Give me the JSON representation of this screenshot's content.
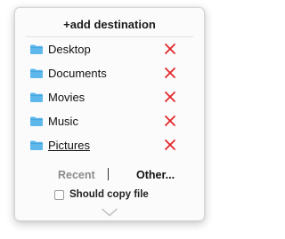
{
  "header": {
    "add_label": "+add destination"
  },
  "destinations": [
    {
      "label": "Desktop",
      "underlined": false
    },
    {
      "label": "Documents",
      "underlined": false
    },
    {
      "label": "Movies",
      "underlined": false
    },
    {
      "label": "Music",
      "underlined": false
    },
    {
      "label": "Pictures",
      "underlined": true
    }
  ],
  "icons": {
    "folder": "folder-icon",
    "remove": "remove-x-icon",
    "expand": "chevron-down-icon"
  },
  "footer": {
    "recent_label": "Recent",
    "separator": "|",
    "other_label": "Other...",
    "copy_checkbox_label": "Should copy file",
    "copy_checked": false
  },
  "colors": {
    "folder": "#5fb8ec",
    "remove": "#e4262b",
    "recent": "#8c8c8c"
  }
}
